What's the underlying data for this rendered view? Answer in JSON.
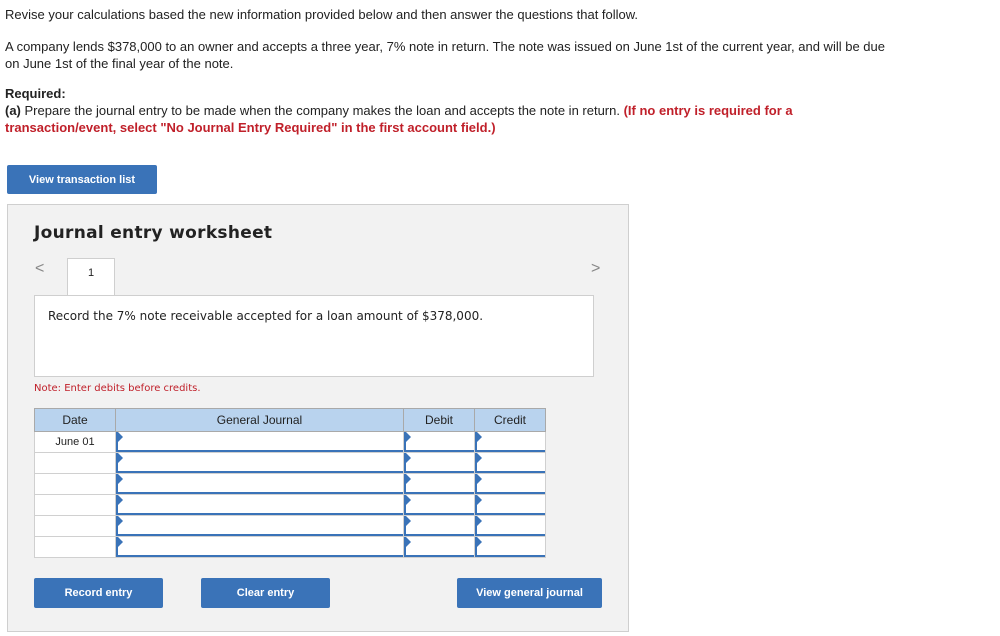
{
  "instructions": "Revise your calculations based the new information provided below and then answer the questions that follow.",
  "problem": "A company lends $378,000 to an owner and accepts a three year, 7% note in return. The note was issued on June 1st of the current year, and will be due on June 1st of the final year of the note.",
  "required": {
    "heading": "Required:",
    "part_label": "(a)",
    "part_text": " Prepare the journal entry to be made when the company makes the loan and accepts the note in return. ",
    "part_note": "(If no entry is required for a transaction/event, select \"No Journal Entry Required\" in the first account field.)"
  },
  "buttons": {
    "view_transaction_list": "View transaction list",
    "record_entry": "Record entry",
    "clear_entry": "Clear entry",
    "view_general_journal": "View general journal"
  },
  "worksheet": {
    "title": "Journal entry worksheet",
    "nav_prev": "<",
    "nav_next": ">",
    "tab_number": "1",
    "description": "Record the 7% note receivable accepted for a loan amount of $378,000.",
    "note": "Note: Enter debits before credits.",
    "columns": [
      "Date",
      "General Journal",
      "Debit",
      "Credit"
    ],
    "rows": [
      {
        "date": "June 01",
        "account": "",
        "debit": "",
        "credit": ""
      },
      {
        "date": "",
        "account": "",
        "debit": "",
        "credit": ""
      },
      {
        "date": "",
        "account": "",
        "debit": "",
        "credit": ""
      },
      {
        "date": "",
        "account": "",
        "debit": "",
        "credit": ""
      },
      {
        "date": "",
        "account": "",
        "debit": "",
        "credit": ""
      },
      {
        "date": "",
        "account": "",
        "debit": "",
        "credit": ""
      }
    ]
  }
}
